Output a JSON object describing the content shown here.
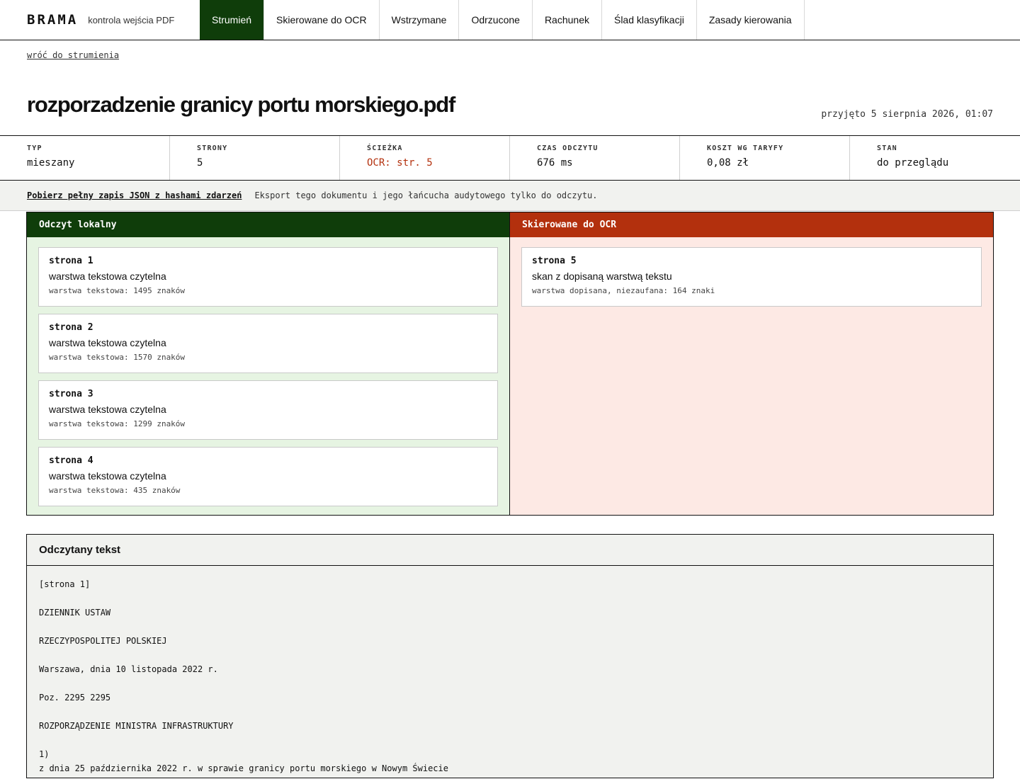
{
  "brand": {
    "name": "BRAMA",
    "subtitle": "kontrola wejścia PDF"
  },
  "nav": {
    "tabs": [
      {
        "label": "Strumień",
        "active": true
      },
      {
        "label": "Skierowane do OCR",
        "active": false
      },
      {
        "label": "Wstrzymane",
        "active": false
      },
      {
        "label": "Odrzucone",
        "active": false
      },
      {
        "label": "Rachunek",
        "active": false
      },
      {
        "label": "Ślad klasyfikacji",
        "active": false
      },
      {
        "label": "Zasady kierowania",
        "active": false
      }
    ]
  },
  "back_link": "wróć do strumienia",
  "document": {
    "title": "rozporzadzenie granicy portu morskiego.pdf",
    "received": "przyjęto 5 sierpnia 2026, 01:07"
  },
  "stats": [
    {
      "label": "TYP",
      "value": "mieszany"
    },
    {
      "label": "STRONY",
      "value": "5"
    },
    {
      "label": "ŚCIEŻKA",
      "value": "OCR: str. 5"
    },
    {
      "label": "CZAS ODCZYTU",
      "value": "676 ms"
    },
    {
      "label": "KOSZT WG TARYFY",
      "value": "0,08 zł"
    },
    {
      "label": "STAN",
      "value": "do przeglądu"
    }
  ],
  "export": {
    "link": "Pobierz pełny zapis JSON z hashami zdarzeń",
    "note": "Eksport tego dokumentu i jego łańcucha audytowego tylko do odczytu."
  },
  "local": {
    "heading": "Odczyt lokalny",
    "pages": [
      {
        "name": "strona 1",
        "desc": "warstwa tekstowa czytelna",
        "meta": "warstwa tekstowa: 1495 znaków"
      },
      {
        "name": "strona 2",
        "desc": "warstwa tekstowa czytelna",
        "meta": "warstwa tekstowa: 1570 znaków"
      },
      {
        "name": "strona 3",
        "desc": "warstwa tekstowa czytelna",
        "meta": "warstwa tekstowa: 1299 znaków"
      },
      {
        "name": "strona 4",
        "desc": "warstwa tekstowa czytelna",
        "meta": "warstwa tekstowa: 435 znaków"
      }
    ]
  },
  "ocr": {
    "heading": "Skierowane do OCR",
    "pages": [
      {
        "name": "strona 5",
        "desc": "skan z dopisaną warstwą tekstu",
        "meta": "warstwa dopisana, niezaufana: 164 znaki"
      }
    ]
  },
  "read_text": {
    "heading": "Odczytany tekst",
    "body": "[strona 1]\n\nDZIENNIK USTAW\n\nRZECZYPOSPOLITEJ POLSKIEJ\n\nWarszawa, dnia 10 listopada 2022 r.\n\nPoz. 2295 2295\n\nROZPORZĄDZENIE MINISTRA INFRASTRUKTURY\n\n1)\nz dnia 25 października 2022 r. w sprawie granicy portu morskiego w Nowym Świecie"
  },
  "colors": {
    "accent_green": "#0f3d0a",
    "accent_red": "#b3300d",
    "local_bg": "#e6f4e2",
    "ocr_bg": "#fde9e4"
  }
}
